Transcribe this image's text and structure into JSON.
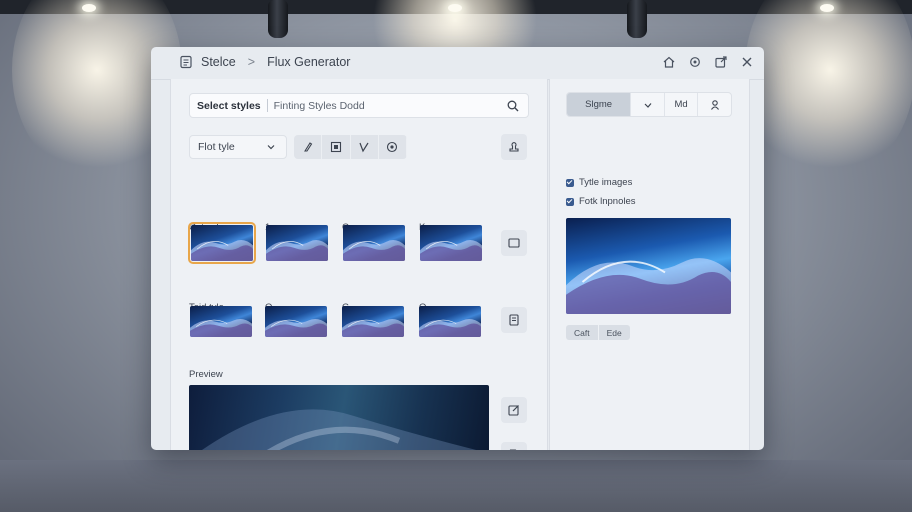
{
  "app": {
    "breadcrumb_root": "Stelce",
    "breadcrumb_sep": ">",
    "title": "Flux Generator"
  },
  "titlebar_icons": [
    "home-icon",
    "settings-icon",
    "export-icon",
    "close-icon"
  ],
  "search": {
    "label": "Select styles",
    "value": "Finting Styles Dodd"
  },
  "toolbar": {
    "style_select": "Flot tyle",
    "tools": [
      "brush-icon",
      "image-icon",
      "pen-icon",
      "globe-icon"
    ]
  },
  "gallery": {
    "row1": {
      "headers": [
        "Cotmyle",
        "1",
        "C",
        "K"
      ]
    },
    "row2": {
      "headers": [
        "Teid tyle",
        "O",
        "C",
        "O"
      ]
    }
  },
  "preview": {
    "label": "Preview"
  },
  "side_buttons": [
    "stamp-icon",
    "frame-icon",
    "document-icon",
    "edit-icon",
    "file-icon"
  ],
  "right": {
    "segments": [
      "Slgme",
      "Md"
    ],
    "checkboxes": [
      {
        "label": "Tytle images",
        "checked": true
      },
      {
        "label": "Fotk lnpnoles",
        "checked": true
      }
    ],
    "pills": [
      "Caft",
      "Ede"
    ]
  },
  "colors": {
    "accent": "#e8a64a",
    "check": "#3a5b8f",
    "panel": "#eef1f5"
  }
}
